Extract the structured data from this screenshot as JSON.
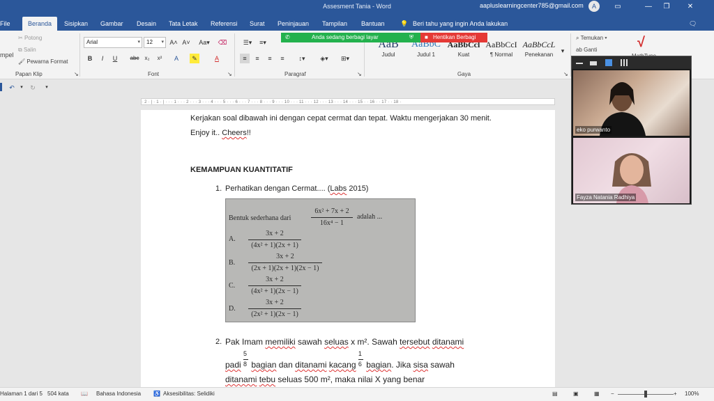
{
  "window": {
    "title": "Assesment Tania  -  Word",
    "user_email": "aapluslearningcenter785@gmail.com",
    "avatar_letter": "A"
  },
  "tabs": [
    "File",
    "Beranda",
    "Sisipkan",
    "Gambar",
    "Desain",
    "Tata Letak",
    "Referensi",
    "Surat",
    "Peninjauan",
    "Tampilan",
    "Bantuan"
  ],
  "active_tab": "Beranda",
  "tell_me": "Beri tahu yang ingin Anda lakukan",
  "clipboard": {
    "paste_label": "mpel",
    "cut": "Potong",
    "copy": "Salin",
    "format_painter": "Pewarna Format",
    "group": "Papan Klip"
  },
  "font": {
    "name": "Arial",
    "size": "12",
    "group": "Font"
  },
  "paragraph": {
    "group": "Paragraf"
  },
  "styles": {
    "items": [
      {
        "sample": "AaB",
        "label": "Judul"
      },
      {
        "sample": "AaBbC",
        "label": "Judul 1"
      },
      {
        "sample": "AaBbCcl",
        "label": "Kuat"
      },
      {
        "sample": "AaBbCcI",
        "label": "¶ Normal"
      },
      {
        "sample": "AaBbCcL",
        "label": "Penekanan"
      }
    ],
    "group": "Gaya"
  },
  "editing": {
    "find": "Temukan",
    "replace": "Ganti"
  },
  "mathtype": "MathType",
  "share": {
    "status": "Anda sedang berbagi layar",
    "stop": "Hentikan Berbagi"
  },
  "ruler_marks": "· 2 · | · 1 · | · · · 1 · · · 2 · · · 3 · · · 4 · · · 5 · · · 6 · · · 7 · · · 8 · · · 9 · · · 10 · · · 11 · · · 12 · · · 13 · · · 14 · · · 15 · · 16 · · 17 · · 18 ·",
  "document": {
    "intro_1": "Kerjakan soal dibawah ini dengan cepat cermat dan tepat. Waktu mengerjakan 30 menit.",
    "intro_2a": "Enjoy it.. ",
    "intro_2b": "Cheers",
    "intro_2c": "!!",
    "section": "KEMAMPUAN KUANTITATIF",
    "q1_num": "1.",
    "q1_text_a": "Perhatikan dengan Cermat.... (",
    "q1_text_b": "Labs",
    "q1_text_c": " 2015)",
    "image": {
      "prompt": "Bentuk sederhana dari",
      "expr_num": "6x² + 7x + 2",
      "expr_den": "16x⁴ − 1",
      "prompt_end": "adalah ...",
      "options": [
        {
          "letter": "A.",
          "num": "3x + 2",
          "den": "(4x² + 1)(2x + 1)"
        },
        {
          "letter": "B.",
          "num": "3x + 2",
          "den": "(2x + 1)(2x + 1)(2x − 1)"
        },
        {
          "letter": "C.",
          "num": "3x + 2",
          "den": "(4x² + 1)(2x − 1)"
        },
        {
          "letter": "D.",
          "num": "3x + 2",
          "den": "(2x² + 1)(2x − 1)"
        }
      ]
    },
    "q2_num": "2.",
    "q2_line1": [
      "Pak Imam ",
      "memiliki",
      " sawah ",
      "seluas",
      " x m². Sawah ",
      "tersebut",
      " ",
      "ditanami"
    ],
    "q2_line2": [
      "padi",
      " ",
      "bagian",
      " dan ",
      "ditanami",
      " ",
      "kacang",
      " ",
      "bagian",
      ". Jika ",
      "sisa",
      " sawah"
    ],
    "q2_frac1": {
      "num": "5",
      "den": "8"
    },
    "q2_frac2": {
      "num": "1",
      "den": "6"
    },
    "q2_line3": [
      "ditanami",
      " ",
      "tebu",
      " seluas 500 m², maka nilai X yang benar"
    ]
  },
  "status": {
    "page": "Halaman 1 dari 5",
    "words": "504 kata",
    "language": "Bahasa Indonesia",
    "accessibility": "Aksesibilitas: Selidiki",
    "zoom": "100%"
  },
  "video": {
    "participant_1": "eko purwanto",
    "participant_2": "Fayza Natania Radhiya"
  },
  "colors": {
    "word_blue": "#2b579a",
    "share_green": "#23b14d",
    "share_red": "#e53935",
    "mathtype_red": "#d32f2f"
  }
}
